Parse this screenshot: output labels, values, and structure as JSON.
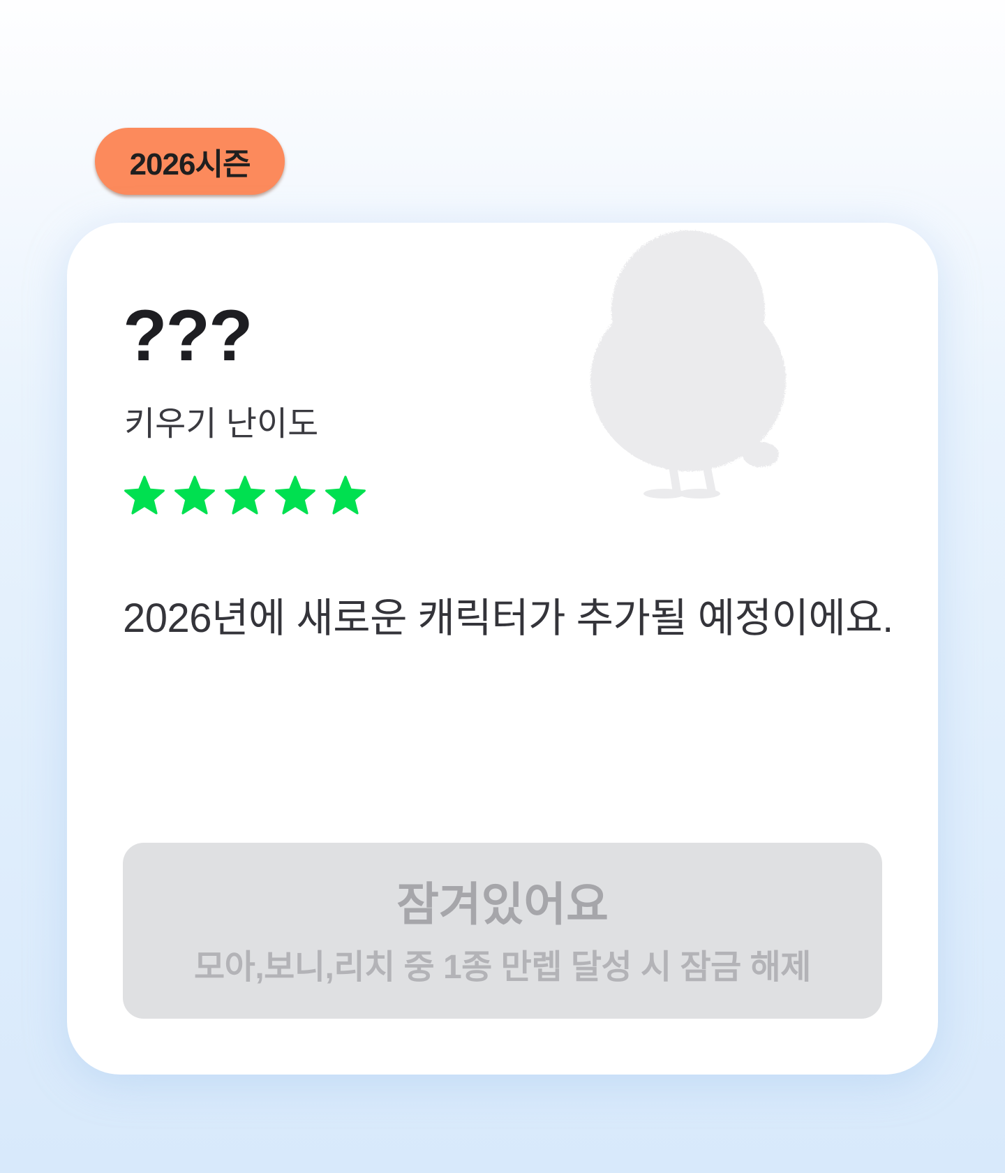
{
  "season_badge": {
    "label": "2026시즌",
    "color": "#fc8a5c"
  },
  "character": {
    "name": "???",
    "image": "locked-character-silhouette",
    "difficulty_label": "키우기 난이도",
    "difficulty_stars": 5,
    "difficulty_max": 5,
    "star_color": "#00e050",
    "description": "2026년에 새로운 캐릭터가 추가될 예정이에요."
  },
  "lock_button": {
    "title": "잠겨있어요",
    "subtitle": "모아,보니,리치 중 1종 만렙 달성 시 잠금 해제"
  }
}
